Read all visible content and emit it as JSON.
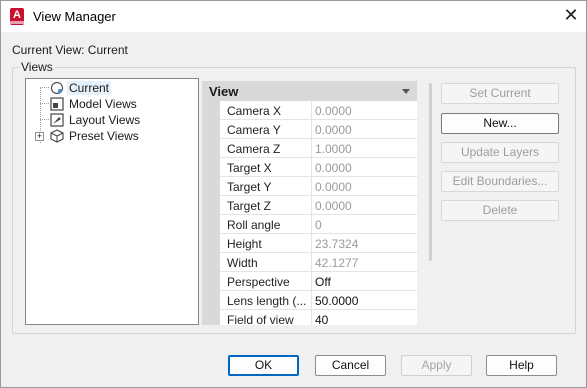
{
  "window": {
    "title": "View Manager",
    "close_glyph": "✕",
    "app_icon": {
      "name": "autocad-icon",
      "glyph": "A",
      "color": "#c8102e"
    }
  },
  "current_view_label": "Current View: Current",
  "views_group_label": "Views",
  "tree": {
    "items": [
      {
        "label": "Current",
        "icon": "current-view-icon",
        "selected": true
      },
      {
        "label": "Model Views",
        "icon": "model-views-icon"
      },
      {
        "label": "Layout Views",
        "icon": "layout-views-icon"
      },
      {
        "label": "Preset Views",
        "icon": "preset-views-icon",
        "expander": "+"
      }
    ]
  },
  "properties": {
    "section": "View",
    "rows": [
      {
        "name": "Camera X",
        "value": "0.0000"
      },
      {
        "name": "Camera Y",
        "value": "0.0000"
      },
      {
        "name": "Camera Z",
        "value": "1.0000"
      },
      {
        "name": "Target X",
        "value": "0.0000"
      },
      {
        "name": "Target Y",
        "value": "0.0000"
      },
      {
        "name": "Target Z",
        "value": "0.0000"
      },
      {
        "name": "Roll angle",
        "value": "0"
      },
      {
        "name": "Height",
        "value": "23.7324"
      },
      {
        "name": "Width",
        "value": "42.1277"
      },
      {
        "name": "Perspective",
        "value": "Off"
      },
      {
        "name": "Lens length (...",
        "value": "50.0000"
      },
      {
        "name": "Field of view",
        "value": "40"
      }
    ]
  },
  "side_buttons": {
    "set_current": "Set Current",
    "new": "New...",
    "update_layers": "Update Layers",
    "edit_boundaries": "Edit Boundaries...",
    "delete": "Delete"
  },
  "footer_buttons": {
    "ok": "OK",
    "cancel": "Cancel",
    "apply": "Apply",
    "help": "Help"
  },
  "colors": {
    "accent": "#0067c0",
    "selection": "#e5f1fb",
    "header": "#d9d9d9"
  }
}
